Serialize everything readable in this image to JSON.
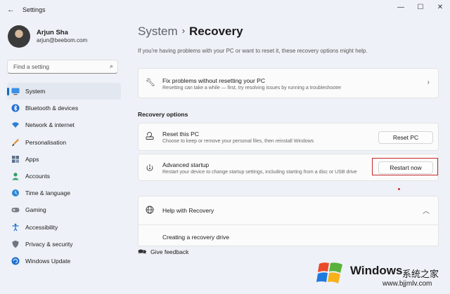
{
  "window": {
    "title": "Settings",
    "back_icon": "arrow-left-icon",
    "controls": [
      "—",
      "☐",
      "✕"
    ]
  },
  "profile": {
    "name": "Arjun Sha",
    "email": "arjun@beebom.com"
  },
  "search": {
    "placeholder": "Find a setting"
  },
  "sidebar": {
    "items": [
      {
        "label": "System",
        "icon": "monitor-icon",
        "selected": true
      },
      {
        "label": "Bluetooth & devices",
        "icon": "bluetooth-icon"
      },
      {
        "label": "Network & internet",
        "icon": "wifi-icon"
      },
      {
        "label": "Personalisation",
        "icon": "brush-icon"
      },
      {
        "label": "Apps",
        "icon": "apps-icon"
      },
      {
        "label": "Accounts",
        "icon": "person-icon"
      },
      {
        "label": "Time & language",
        "icon": "globe-clock-icon"
      },
      {
        "label": "Gaming",
        "icon": "gamepad-icon"
      },
      {
        "label": "Accessibility",
        "icon": "accessibility-icon"
      },
      {
        "label": "Privacy & security",
        "icon": "shield-icon"
      },
      {
        "label": "Windows Update",
        "icon": "update-icon"
      }
    ]
  },
  "breadcrumb": {
    "parent": "System",
    "separator": "›",
    "current": "Recovery"
  },
  "intro_text": "If you're having problems with your PC or want to reset it, these recovery options might help.",
  "fix_card": {
    "title": "Fix problems without resetting your PC",
    "desc": "Resetting can take a while — first, try resolving issues by running a troubleshooter"
  },
  "recovery_options": {
    "heading": "Recovery options",
    "reset": {
      "title": "Reset this PC",
      "desc": "Choose to keep or remove your personal files, then reinstall Windows",
      "button": "Reset PC"
    },
    "advanced": {
      "title": "Advanced startup",
      "desc": "Restart your device to change startup settings, including starting from a disc or USB drive",
      "button": "Restart now"
    }
  },
  "help": {
    "title": "Help with Recovery",
    "link": "Creating a recovery drive"
  },
  "feedback": {
    "label": "Give feedback"
  },
  "watermark": {
    "brand": "Windows",
    "cn": "系统之家",
    "url": "www.bjjmlv.com"
  },
  "colors": {
    "accent": "#0f6cbd",
    "highlight": "#c62828"
  }
}
